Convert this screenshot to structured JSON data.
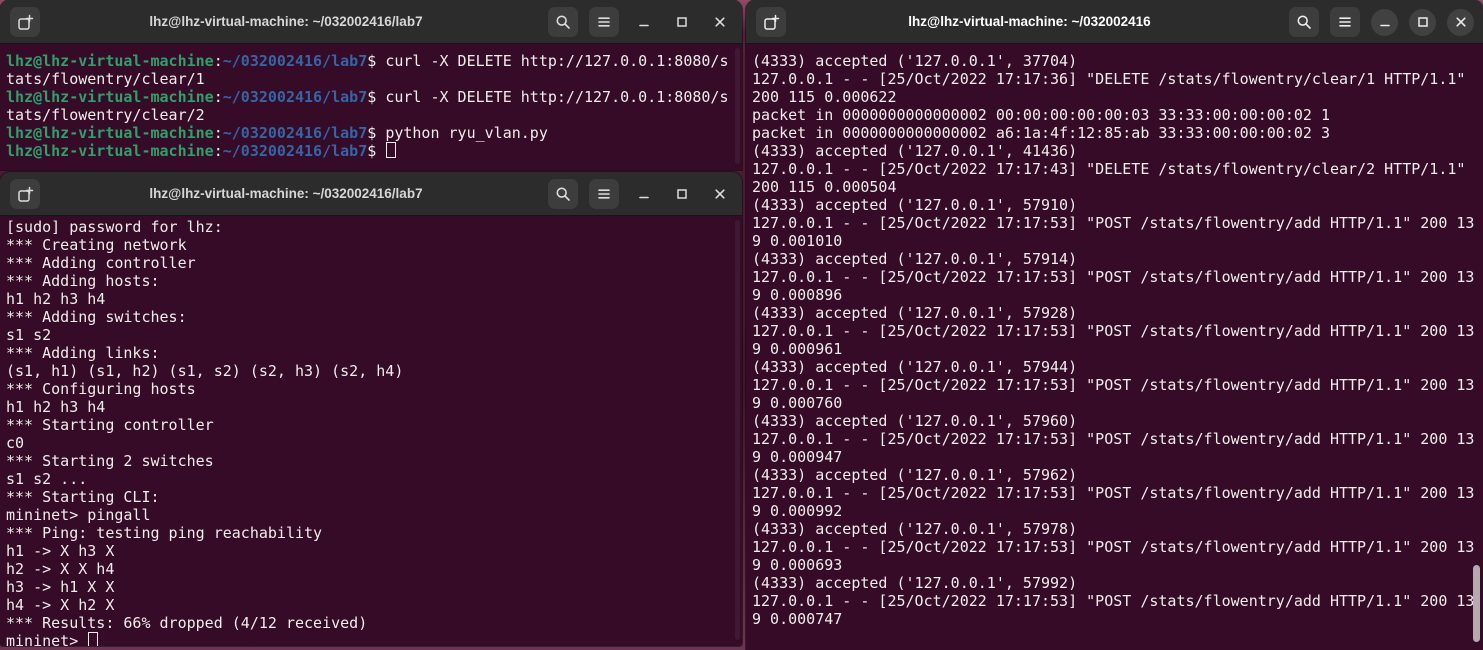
{
  "colors": {
    "terminal_bg": "#350b28",
    "titlebar_bg": "#2c2c2c",
    "button_bg": "#3d3d3d",
    "control_circle_bg": "#414141",
    "terminal_fg": "#f0ecea",
    "prompt_user_green": "#2aa269",
    "prompt_path_blue": "#3465a4",
    "scrollbar_thumb": "#b3abb0",
    "wallpaper_accent": "#6d3350"
  },
  "prompt_parts": {
    "user": "lhz@lhz-virtual-machine",
    "separator": ":",
    "path": "~/032002416/lab7",
    "suffix": "$ "
  },
  "windows": {
    "top_left": {
      "title": "lhz@lhz-virtual-machine: ~/032002416/lab7",
      "lines": [
        {
          "prompt": true,
          "cmd": "curl -X DELETE http://127.0.0.1:8080/s"
        },
        {
          "text": "tats/flowentry/clear/1"
        },
        {
          "prompt": true,
          "cmd": "curl -X DELETE http://127.0.0.1:8080/s"
        },
        {
          "text": "tats/flowentry/clear/2"
        },
        {
          "prompt": true,
          "cmd": "python ryu_vlan.py"
        },
        {
          "prompt": true,
          "cmd": "",
          "cursor": true
        }
      ]
    },
    "bottom_left": {
      "title": "lhz@lhz-virtual-machine: ~/032002416/lab7",
      "lines": [
        {
          "text": "[sudo] password for lhz: "
        },
        {
          "text": "*** Creating network"
        },
        {
          "text": "*** Adding controller"
        },
        {
          "text": "*** Adding hosts:"
        },
        {
          "text": "h1 h2 h3 h4"
        },
        {
          "text": "*** Adding switches:"
        },
        {
          "text": "s1 s2"
        },
        {
          "text": "*** Adding links:"
        },
        {
          "text": "(s1, h1) (s1, h2) (s1, s2) (s2, h3) (s2, h4)"
        },
        {
          "text": "*** Configuring hosts"
        },
        {
          "text": "h1 h2 h3 h4"
        },
        {
          "text": "*** Starting controller"
        },
        {
          "text": "c0"
        },
        {
          "text": "*** Starting 2 switches"
        },
        {
          "text": "s1 s2 ..."
        },
        {
          "text": "*** Starting CLI:"
        },
        {
          "text": "mininet> pingall"
        },
        {
          "text": "*** Ping: testing ping reachability"
        },
        {
          "text": "h1 -> X h3 X "
        },
        {
          "text": "h2 -> X X h4 "
        },
        {
          "text": "h3 -> h1 X X "
        },
        {
          "text": "h4 -> X h2 X "
        },
        {
          "text": "*** Results: 66% dropped (4/12 received)"
        },
        {
          "text": "mininet> ",
          "cursor": true
        }
      ]
    },
    "right": {
      "title": "lhz@lhz-virtual-machine: ~/032002416",
      "lines": [
        {
          "text": "(4333) accepted ('127.0.0.1', 37704)"
        },
        {
          "text": "127.0.0.1 - - [25/Oct/2022 17:17:36] \"DELETE /stats/flowentry/clear/1 HTTP/1.1\""
        },
        {
          "text": "200 115 0.000622"
        },
        {
          "text": "packet in 0000000000000002 00:00:00:00:00:03 33:33:00:00:00:02 1"
        },
        {
          "text": "packet in 0000000000000002 a6:1a:4f:12:85:ab 33:33:00:00:00:02 3"
        },
        {
          "text": "(4333) accepted ('127.0.0.1', 41436)"
        },
        {
          "text": "127.0.0.1 - - [25/Oct/2022 17:17:43] \"DELETE /stats/flowentry/clear/2 HTTP/1.1\""
        },
        {
          "text": "200 115 0.000504"
        },
        {
          "text": "(4333) accepted ('127.0.0.1', 57910)"
        },
        {
          "text": "127.0.0.1 - - [25/Oct/2022 17:17:53] \"POST /stats/flowentry/add HTTP/1.1\" 200 13"
        },
        {
          "text": "9 0.001010"
        },
        {
          "text": "(4333) accepted ('127.0.0.1', 57914)"
        },
        {
          "text": "127.0.0.1 - - [25/Oct/2022 17:17:53] \"POST /stats/flowentry/add HTTP/1.1\" 200 13"
        },
        {
          "text": "9 0.000896"
        },
        {
          "text": "(4333) accepted ('127.0.0.1', 57928)"
        },
        {
          "text": "127.0.0.1 - - [25/Oct/2022 17:17:53] \"POST /stats/flowentry/add HTTP/1.1\" 200 13"
        },
        {
          "text": "9 0.000961"
        },
        {
          "text": "(4333) accepted ('127.0.0.1', 57944)"
        },
        {
          "text": "127.0.0.1 - - [25/Oct/2022 17:17:53] \"POST /stats/flowentry/add HTTP/1.1\" 200 13"
        },
        {
          "text": "9 0.000760"
        },
        {
          "text": "(4333) accepted ('127.0.0.1', 57960)"
        },
        {
          "text": "127.0.0.1 - - [25/Oct/2022 17:17:53] \"POST /stats/flowentry/add HTTP/1.1\" 200 13"
        },
        {
          "text": "9 0.000947"
        },
        {
          "text": "(4333) accepted ('127.0.0.1', 57962)"
        },
        {
          "text": "127.0.0.1 - - [25/Oct/2022 17:17:53] \"POST /stats/flowentry/add HTTP/1.1\" 200 13"
        },
        {
          "text": "9 0.000992"
        },
        {
          "text": "(4333) accepted ('127.0.0.1', 57978)"
        },
        {
          "text": "127.0.0.1 - - [25/Oct/2022 17:17:53] \"POST /stats/flowentry/add HTTP/1.1\" 200 13"
        },
        {
          "text": "9 0.000693"
        },
        {
          "text": "(4333) accepted ('127.0.0.1', 57992)"
        },
        {
          "text": "127.0.0.1 - - [25/Oct/2022 17:17:53] \"POST /stats/flowentry/add HTTP/1.1\" 200 13"
        },
        {
          "text": "9 0.000747"
        }
      ]
    }
  }
}
